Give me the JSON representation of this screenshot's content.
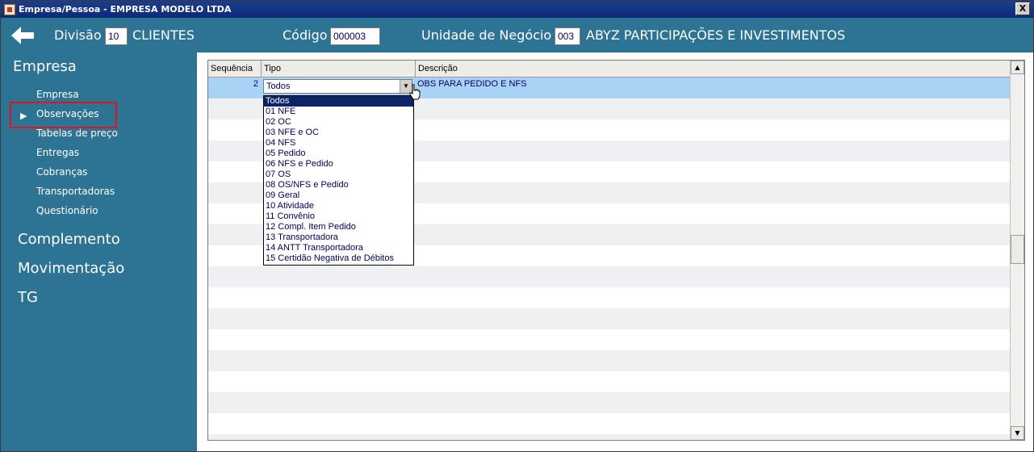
{
  "window": {
    "title": "Empresa/Pessoa - EMPRESA MODELO LTDA",
    "close_label": "X"
  },
  "header": {
    "divisao_label": "Divisão",
    "divisao_code": "10",
    "divisao_name": "CLIENTES",
    "codigo_label": "Código",
    "codigo_value": "000003",
    "unidade_label": "Unidade de Negócio",
    "unidade_code": "003",
    "unidade_name": "ABYZ PARTICIPAÇÕES E INVESTIMENTOS"
  },
  "sidebar": {
    "sections": [
      "Empresa",
      "Complemento",
      "Movimentação",
      "TG"
    ],
    "items": [
      "Empresa",
      "Observações",
      "Tabelas de preço",
      "Entregas",
      "Cobranças",
      "Transportadoras",
      "Questionário"
    ],
    "selected_item": "Observações"
  },
  "grid": {
    "columns": [
      "Sequência",
      "Tipo",
      "Descrição"
    ],
    "rows": [
      {
        "sequencia": "2",
        "tipo": "Todos",
        "descricao": "OBS PARA PEDIDO E NFS"
      }
    ]
  },
  "dropdown": {
    "selected": "Todos",
    "options": [
      "Todos",
      "01 NFE",
      "02 OC",
      "03 NFE e OC",
      "04 NFS",
      "05 Pedido",
      "06 NFS e Pedido",
      "07 OS",
      "08 OS/NFS e Pedido",
      "09 Geral",
      "10 Atividade",
      "11 Convênio",
      "12 Compl. Item Pedido",
      "13 Transportadora",
      "14 ANTT Transportadora",
      "15 Certidão Negativa de Débitos"
    ]
  },
  "colors": {
    "accent": "#2c7394",
    "title_bar": "#0a246a",
    "selection_row": "#a9d3f5",
    "highlight_box": "#e0141e"
  },
  "icons": {
    "back": "arrow-left-icon",
    "dropdown": "chevron-down-icon",
    "cursor": "hand-pointer-icon"
  }
}
